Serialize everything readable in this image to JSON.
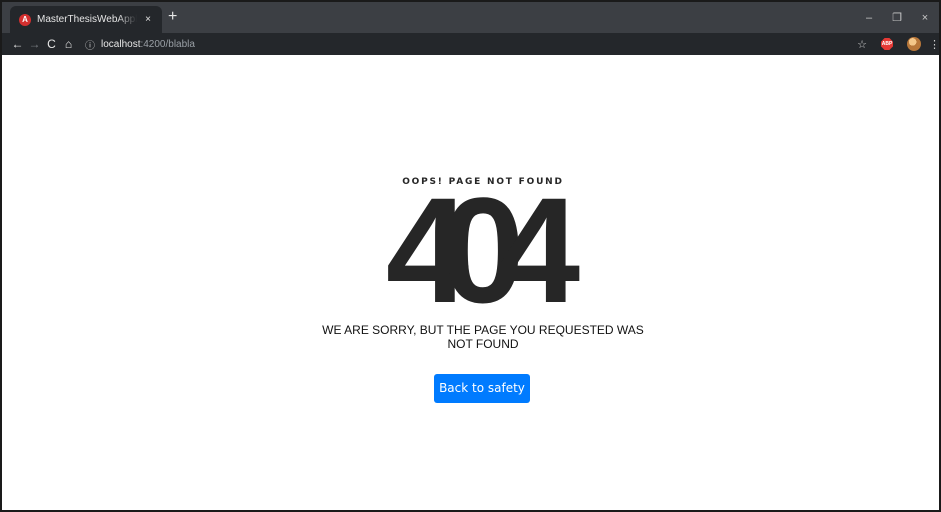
{
  "browser": {
    "tab": {
      "favicon": "A",
      "title": "MasterThesisWebApplicationFrontend",
      "close": "×"
    },
    "new_tab": "+",
    "window_controls": {
      "minimize": "–",
      "restore": "❐",
      "close": "×"
    },
    "toolbar": {
      "back": "←",
      "forward": "→",
      "reload": "C",
      "home": "⌂",
      "info": "ⓘ",
      "url_host": "localhost",
      "url_path": ":4200/blabla",
      "star": "☆",
      "abp": "ABP",
      "menu": "⋮"
    }
  },
  "page": {
    "heading": "OOPS! PAGE NOT FOUND",
    "code": "404",
    "message": "WE ARE SORRY, BUT THE PAGE YOU REQUESTED WAS NOT FOUND",
    "button_label": "Back to safety"
  },
  "colors": {
    "accent": "#007bff",
    "text_dark": "#262626",
    "chrome_tabstrip": "#3c3f44",
    "chrome_toolbar": "#24272b"
  }
}
